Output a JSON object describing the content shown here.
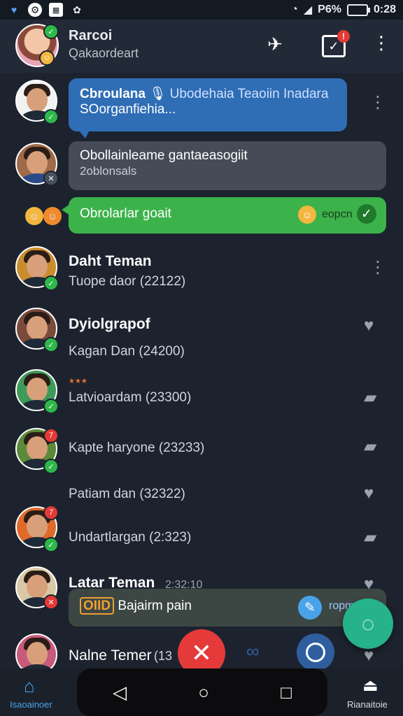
{
  "status_bar": {
    "battery": "P6%",
    "time": "0:28"
  },
  "header": {
    "title": "Rarcoi",
    "subtitle": "Qakaordeart"
  },
  "rows": [
    {
      "bubble": "Cbroulana",
      "bubble_extra": "Ubodehaia Teaoiin Inadara",
      "bubble_line2": "SOorganfiehia..."
    },
    {
      "bubble": "Obollainleame gantaeasogiit",
      "bubble_line2": "2oblonsals"
    },
    {
      "bubble": "Obrolarlar goait",
      "bubble_extra": "eopcn"
    },
    {
      "name": "Daht Teman",
      "sub": "Tuope daor (22122)"
    },
    {
      "name": "Dyiolgrapof",
      "sub": "Kagan Dan (24200)"
    },
    {
      "stars": "★★★",
      "sub": "Latvioardam (23300)"
    },
    {
      "sub": "Kapte haryone (23233)"
    },
    {
      "sub": "Patiam dan (32322)"
    },
    {
      "sub": "Undartlargan (2:323)"
    },
    {
      "name": "Latar Teman",
      "name_extra": "2:32:10"
    },
    {
      "name": "Nalne Temer",
      "name_extra": "(13"
    }
  ],
  "input_bar": {
    "badge": "OIID",
    "text": "Bajairm pain",
    "right": "ropm"
  },
  "bottom_nav": {
    "left_label": "Isaoainoer",
    "right_label": "Rianaitoie"
  },
  "colors": {
    "accent_blue": "#2f6db5",
    "accent_green": "#3cb24a",
    "fab": "#26b38a",
    "danger": "#e53a3a"
  }
}
